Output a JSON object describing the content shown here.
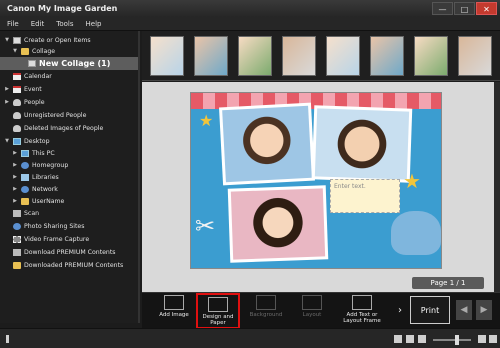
{
  "app": {
    "title": "Canon My Image Garden",
    "min": "—",
    "max": "□",
    "close": "✕"
  },
  "menu": [
    "File",
    "Edit",
    "Tools",
    "Help"
  ],
  "sidebar": {
    "items": [
      {
        "label": "Create or Open Items",
        "icon": "page-icon"
      },
      {
        "label": "Collage",
        "icon": "folder-icon"
      },
      {
        "label": "New Collage (1)",
        "icon": "page-icon"
      },
      {
        "label": "Calendar",
        "icon": "calendar-icon"
      },
      {
        "label": "Event",
        "icon": "event-icon"
      },
      {
        "label": "People",
        "icon": "person-icon"
      },
      {
        "label": "Unregistered People",
        "icon": "person-icon"
      },
      {
        "label": "Deleted Images of People",
        "icon": "person-icon"
      },
      {
        "label": "Desktop",
        "icon": "folder-icon"
      },
      {
        "label": "This PC",
        "icon": "pc-icon"
      },
      {
        "label": "Homegroup",
        "icon": "homegroup-icon"
      },
      {
        "label": "Libraries",
        "icon": "library-icon"
      },
      {
        "label": "Network",
        "icon": "network-icon"
      },
      {
        "label": "UserName",
        "icon": "folder-icon"
      },
      {
        "label": "Scan",
        "icon": "scan-icon"
      },
      {
        "label": "Photo Sharing Sites",
        "icon": "globe-icon"
      },
      {
        "label": "Video Frame Capture",
        "icon": "film-icon"
      },
      {
        "label": "Download PREMIUM Contents",
        "icon": "download-icon"
      },
      {
        "label": "Downloaded PREMIUM Contents",
        "icon": "folder-icon"
      }
    ]
  },
  "preview": {
    "page_label": "Page 1 / 1",
    "textbox_placeholder": "Enter text."
  },
  "toolbar": {
    "add_image": "Add Image",
    "design_paper": "Design and Paper",
    "background": "Background",
    "layout": "Layout",
    "add_text": "Add Text or Layout Frame",
    "print": "Print"
  },
  "colors": {
    "highlight": "#e01010",
    "selected_row": "#5d5d5d"
  }
}
